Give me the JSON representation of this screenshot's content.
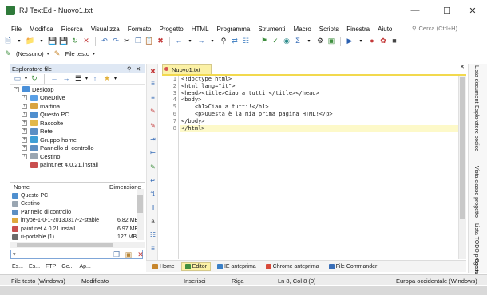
{
  "window": {
    "title": "RJ TextEd - Nuovo1.txt"
  },
  "menu": [
    "File",
    "Modifica",
    "Ricerca",
    "Visualizza",
    "Formato",
    "Progetto",
    "HTML",
    "Programma",
    "Strumenti",
    "Macro",
    "Scripts",
    "Finestra",
    "Aiuto"
  ],
  "search": {
    "placeholder": "Cerca (Ctrl+H)"
  },
  "toolbar2": {
    "highlighter": "(Nessuno)",
    "filetype": "File testo"
  },
  "explorer": {
    "title": "Esploratore file",
    "tree": [
      {
        "label": "Desktop",
        "color": "#4a90d9",
        "indent": 0,
        "expand": "-"
      },
      {
        "label": "OneDrive",
        "color": "#5aa0e6",
        "indent": 1,
        "expand": "+"
      },
      {
        "label": "martina",
        "color": "#d9a441",
        "indent": 1,
        "expand": "+"
      },
      {
        "label": "Questo PC",
        "color": "#4f8fcf",
        "indent": 1,
        "expand": "+"
      },
      {
        "label": "Raccolte",
        "color": "#e3b84a",
        "indent": 1,
        "expand": "+"
      },
      {
        "label": "Rete",
        "color": "#5b8fc4",
        "indent": 1,
        "expand": "+"
      },
      {
        "label": "Gruppo home",
        "color": "#3f9fd6",
        "indent": 1,
        "expand": "+"
      },
      {
        "label": "Pannello di controllo",
        "color": "#5d8fc2",
        "indent": 1,
        "expand": "+"
      },
      {
        "label": "Cestino",
        "color": "#9aa6b2",
        "indent": 1,
        "expand": "+"
      },
      {
        "label": "paint.net 4.0.21.install",
        "color": "#c94f4f",
        "indent": 1,
        "expand": ""
      }
    ]
  },
  "filelist": {
    "col_name": "Nome",
    "col_size": "Dimensione",
    "rows": [
      {
        "name": "Questo PC",
        "size": "",
        "color": "#4f8fcf"
      },
      {
        "name": "Cestino",
        "size": "",
        "color": "#9aa6b2"
      },
      {
        "name": "Pannello di controllo",
        "size": "",
        "color": "#5d8fc2"
      },
      {
        "name": "intype-1-0-1-20130317-2-stable",
        "size": "6.82 MB",
        "color": "#e0a93e"
      },
      {
        "name": "paint.net 4.0.21.install",
        "size": "6.97 MB",
        "color": "#c94f4f"
      },
      {
        "name": "ri-portable (1)",
        "size": "127 MB",
        "color": "#6c6c6c"
      }
    ]
  },
  "left_tabs": [
    "Es...",
    "Es...",
    "FTP",
    "Ge...",
    "Ap..."
  ],
  "doc_tab": {
    "label": "Nuovo1.txt"
  },
  "editor": {
    "lines": [
      "<!doctype html>",
      "<html lang=\"it\">",
      "<head><title>Ciao a tutti!</title></head>",
      "<body>",
      "    <h1>Ciao a tutti!</h1>",
      "    <p>Questa è la mia prima pagina HTML!</p>",
      "</body>",
      "</html>"
    ],
    "active_line": 8
  },
  "right_panel": [
    "Lista documenti",
    "Esploratore codice",
    "Vista classe progetto",
    "Lista TODO progetto",
    "Contr..."
  ],
  "bottom_tabs": [
    "Home",
    "Editor",
    "IE anteprima",
    "Chrome anteprima",
    "File Commander"
  ],
  "status": {
    "filetype": "File testo (Windows)",
    "modified": "Modificato",
    "mode": "Inserisci",
    "row_label": "Riga",
    "position": "Ln 8, Col 8 (0)",
    "encoding": "Europa occidentale (Windows)"
  },
  "colors": {
    "accent_tab": "#fbf1a6",
    "active_line": "#fdf9c9",
    "panel_header": "#dfe8f4"
  }
}
